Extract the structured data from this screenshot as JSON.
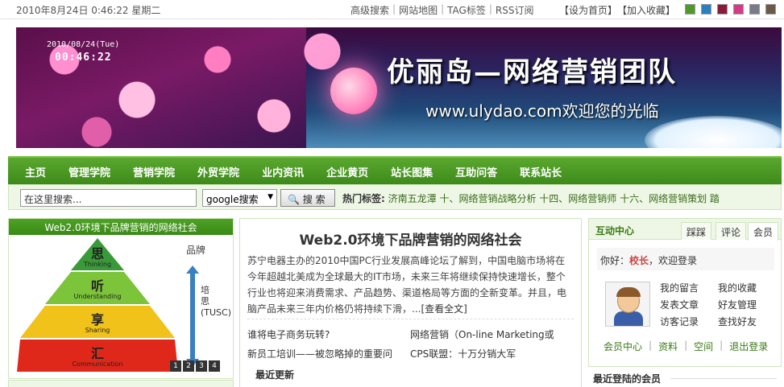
{
  "topbar": {
    "datetime": "2010年8月24日  0:46:22 星期二",
    "links": [
      "高级搜索",
      "网站地图",
      "TAG标签",
      "RSS订阅"
    ],
    "set_home": "【设为首页】",
    "favorite": "【加入收藏】",
    "swatch_colors": [
      "#4d9a2a",
      "#2a7fc0",
      "#8a1a3a",
      "#d43a8a",
      "#7a7a8a",
      "#6b5a4a"
    ]
  },
  "banner": {
    "date_overlay": "2010/08/24(Tue)",
    "time_overlay": "00:46:22",
    "title": "优丽岛—网络营销团队",
    "url_text": "www.ulydao.com欢迎您的光临"
  },
  "nav": {
    "items": [
      "主页",
      "管理学院",
      "营销学院",
      "外贸学院",
      "业内资讯",
      "企业黄页",
      "站长图集",
      "互助问答",
      "联系站长"
    ]
  },
  "search": {
    "placeholder": "在这里搜索...",
    "engine": "google搜索",
    "button": "搜 索",
    "hot_label": "热门标签:",
    "hot_tags": "济南五龙潭 十、网络营销战略分析 十四、网络营销师 十六、网络营销策划 踏"
  },
  "left": {
    "heading": "Web2.0环境下品牌营销的网络社会",
    "pyramid": [
      {
        "cn": "思",
        "en": "Thinking"
      },
      {
        "cn": "听",
        "en": "Understanding"
      },
      {
        "cn": "享",
        "en": "Sharing"
      },
      {
        "cn": "汇",
        "en": "Communication"
      }
    ],
    "side_label": "品牌",
    "arrow_label_top": "培",
    "arrow_label_mid": "思",
    "arrow_label_code": "(TUSC)",
    "pager": [
      "1",
      "2",
      "3",
      "4"
    ]
  },
  "middle": {
    "title": "Web2.0环境下品牌营销的网络社会",
    "description": "苏宁电器主办的2010中国PC行业发展高峰论坛了解到，中国电脑市场将在今年超越北美成为全球最大的IT市场，未来三年将继续保持快速增长，整个行业也将迎来消费需求、产品趋势、渠道格局等方面的全新变革。并且，电脑产品未来三年内价格仍将持续下滑，...",
    "more": "[查看全文]",
    "links_left": [
      "谁将电子商务玩转?",
      "新员工培训——被忽略掉的重要问"
    ],
    "links_right": [
      "网络营销（On-line Marketing或",
      "CPS联盟：十万分销大军"
    ],
    "recent_label": "最近更新"
  },
  "right": {
    "title": "互动中心",
    "tabs": [
      "踩踩",
      "评论",
      "会员"
    ],
    "greeting_prefix": "你好：",
    "greeting_user": "校长",
    "greeting_suffix": "，欢迎登录",
    "user_links": [
      "我的留言",
      "我的收藏",
      "发表文章",
      "好友管理",
      "访客记录",
      "查找好友"
    ],
    "member_links": [
      "会员中心",
      "资料",
      "空间",
      "退出登录"
    ],
    "recent_members": "最近登陆的会员"
  }
}
